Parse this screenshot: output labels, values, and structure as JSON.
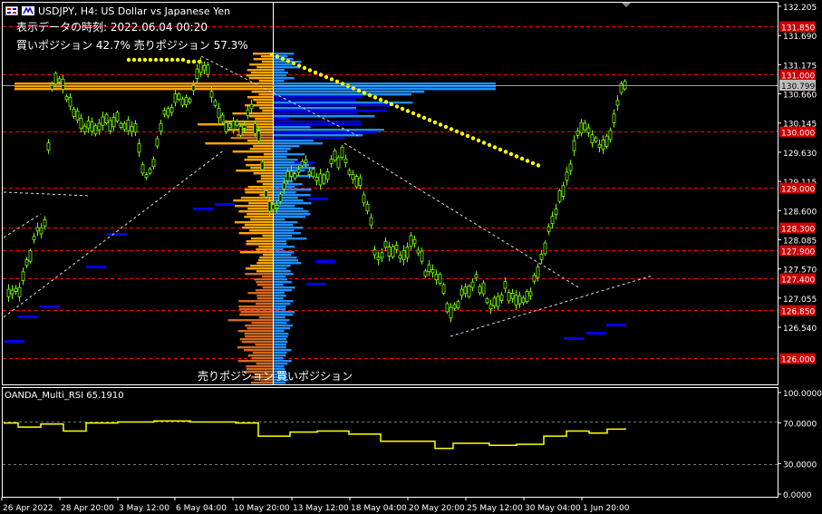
{
  "header": {
    "symbol_line": "USDJPY, H4:  US Dollar vs Japanese Yen",
    "data_time": "表示データの時刻: 2022.06.04 00:20",
    "position_ratio": "買いポジション 42.7% 売りポジション 57.3%",
    "sell_label": "売りポジション",
    "buy_label": "買いポジション"
  },
  "indicator": {
    "label": "OANDA_Multi_RSI 65.1910",
    "axis": [
      "100.0000",
      "70.0000",
      "30.0000",
      "0.0000"
    ]
  },
  "price_axis": [
    "132.205",
    "131.690",
    "131.175",
    "130.660",
    "130.145",
    "129.630",
    "129.115",
    "128.600",
    "128.085",
    "127.570",
    "127.055",
    "126.540"
  ],
  "level_tags": [
    "131.850",
    "131.000",
    "130.000",
    "129.000",
    "128.300",
    "127.900",
    "127.400",
    "126.850",
    "126.000"
  ],
  "current_price": "130.799",
  "time_axis": [
    "26 Apr 2022",
    "28 Apr 20:00",
    "3 May 12:00",
    "6 May 04:00",
    "10 May 20:00",
    "13 May 12:00",
    "18 May 04:00",
    "20 May 20:00",
    "25 May 12:00",
    "30 May 04:00",
    "1 Jun 20:00"
  ],
  "colors": {
    "candle": "#7CFC00",
    "sell_orders": "#FFA500",
    "buy_orders": "#1E90FF",
    "level_line": "#FF0000",
    "level_tag_bg": "#CC0000",
    "current_tag_bg": "#BDBDBD",
    "rsi_line": "#FFFF00",
    "yellow_dots": "#FFFF00",
    "blue_dashes": "#0000FF",
    "axis": "#FFFFFF"
  }
}
